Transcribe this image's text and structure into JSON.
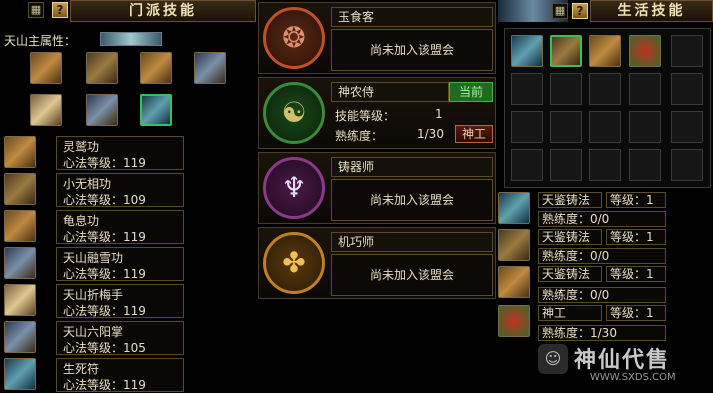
{
  "sect_panel": {
    "help_button": "?",
    "title": "门派技能",
    "main_attr_label": "天山主属性：",
    "skills": [
      {
        "name": "灵鹫功",
        "level_text": "心法等级：119"
      },
      {
        "name": "小无相功",
        "level_text": "心法等级：109"
      },
      {
        "name": "龟息功",
        "level_text": "心法等级：119"
      },
      {
        "name": "天山融雪功",
        "level_text": "心法等级：119"
      },
      {
        "name": "天山折梅手",
        "level_text": "心法等级：119"
      },
      {
        "name": "天山六阳掌",
        "level_text": "心法等级：105"
      },
      {
        "name": "生死符",
        "level_text": "心法等级：119"
      }
    ]
  },
  "professions": [
    {
      "name": "玉食客",
      "status": "尚未加入该盟会",
      "icon": "dragon-medal-icon",
      "color": "#c0502a"
    },
    {
      "name": "神农侍",
      "current_tag": "当前",
      "skill_level_label": "技能等级：",
      "skill_level_value": "1",
      "proficiency_label": "熟练度：",
      "proficiency_value": "1/30",
      "button": "神工",
      "icon": "yinyang-medal-icon",
      "color": "#3a8a3a"
    },
    {
      "name": "铸器师",
      "status": "尚未加入该盟会",
      "icon": "trident-medal-icon",
      "color": "#8a3a8a"
    },
    {
      "name": "机巧师",
      "status": "尚未加入该盟会",
      "icon": "gear-medal-icon",
      "color": "#c08020"
    }
  ],
  "life_panel": {
    "help_button": "?",
    "title": "生活技能",
    "entries": [
      {
        "name": "天鉴铸法",
        "level": "等级：1",
        "proficiency": "熟练度：0/0"
      },
      {
        "name": "天鉴铸法",
        "level": "等级：1",
        "proficiency": "熟练度：0/0"
      },
      {
        "name": "天鉴铸法",
        "level": "等级：1",
        "proficiency": "熟练度：0/0"
      },
      {
        "name": "神工",
        "level": "等级：1",
        "proficiency": "熟练度：1/30"
      }
    ]
  },
  "watermark": {
    "text": "神仙代售",
    "url": "WWW.SXDS.COM"
  }
}
